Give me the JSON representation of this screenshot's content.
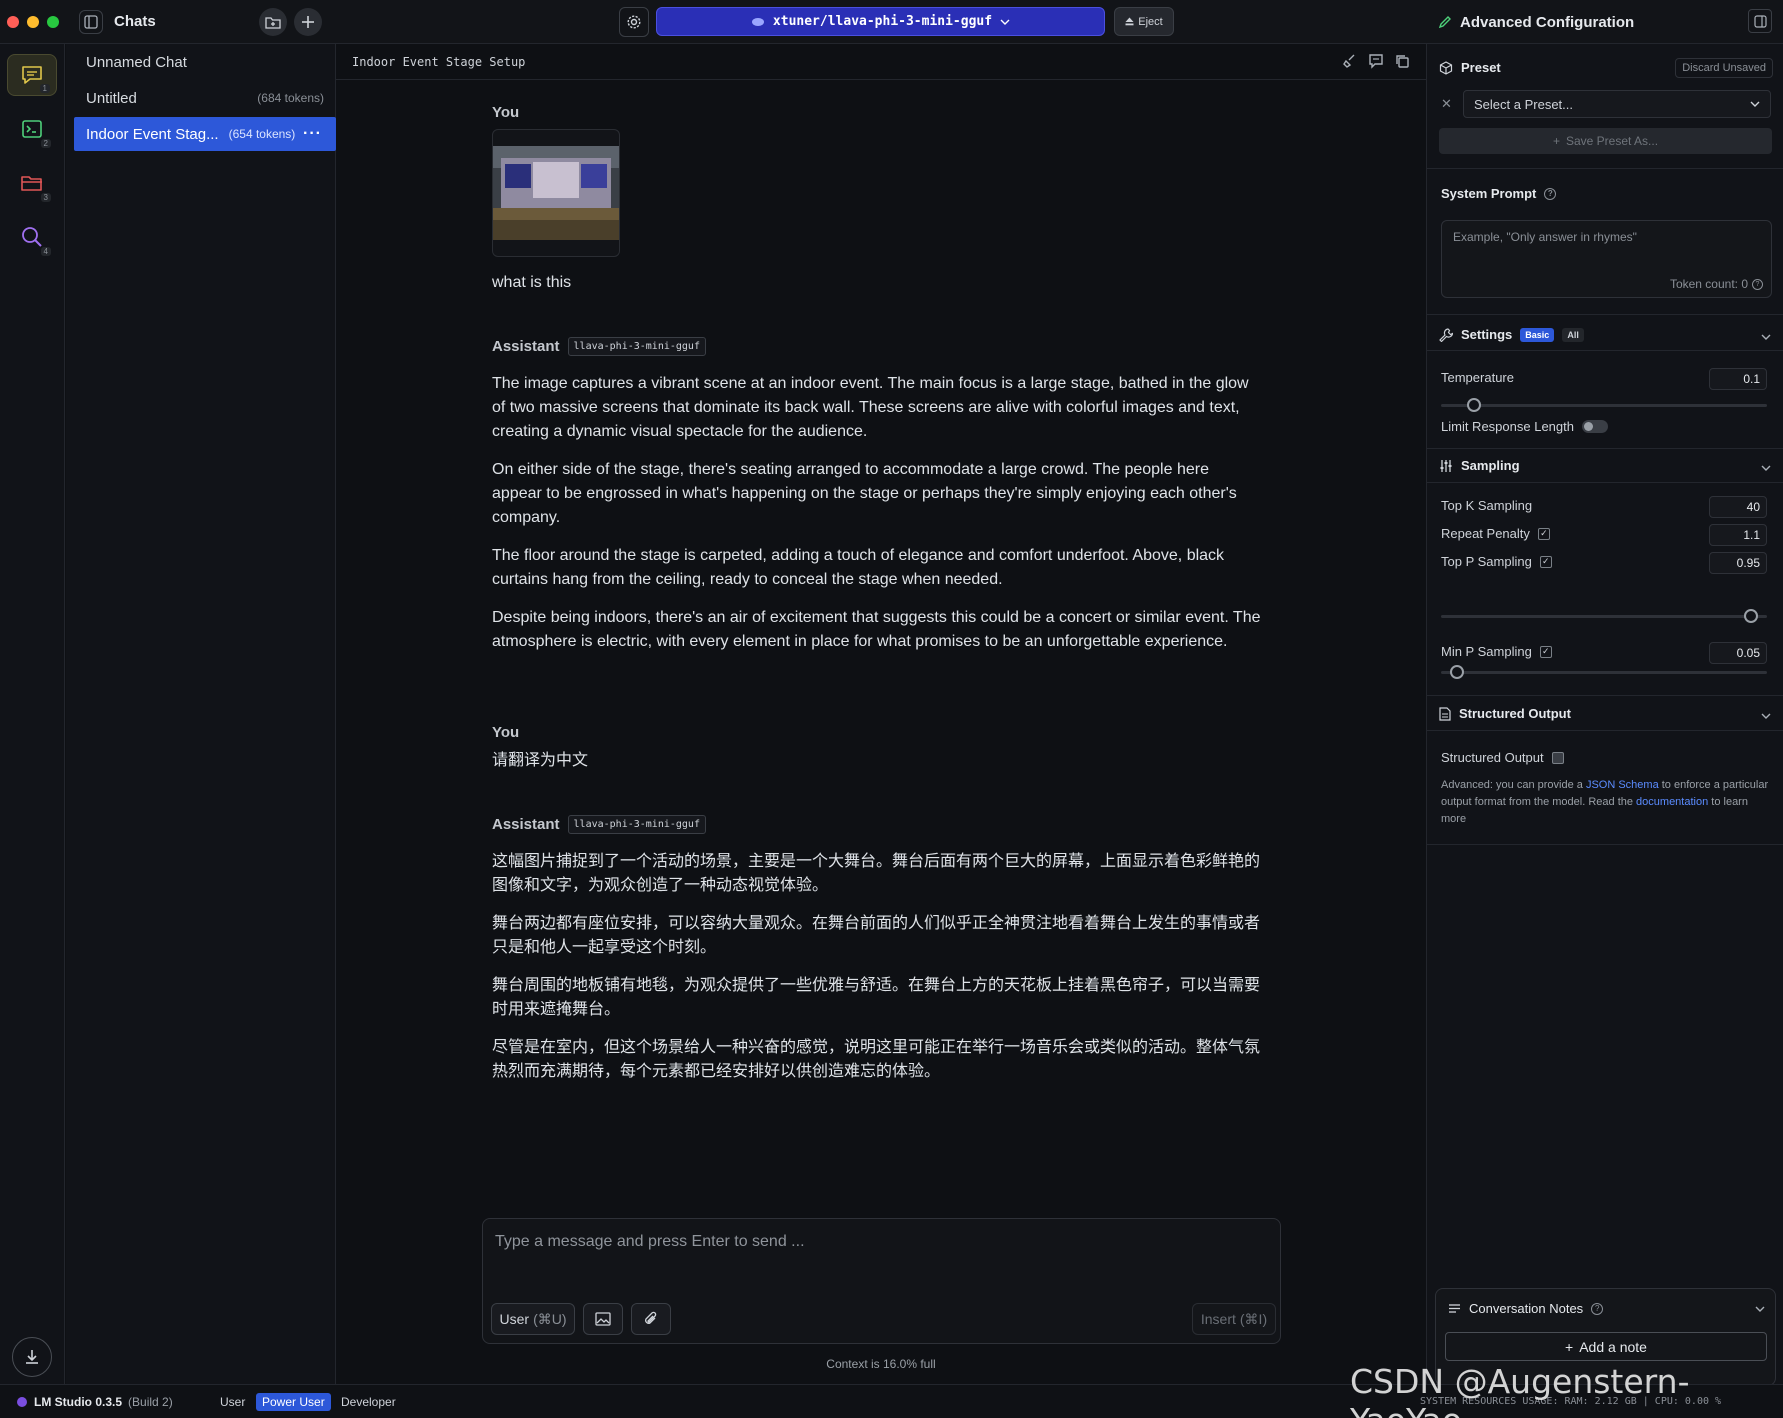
{
  "titlebar": {
    "chats_title": "Chats",
    "model_name": "xtuner/llava-phi-3-mini-gguf",
    "eject_label": "Eject",
    "panel_title": "Advanced Configuration"
  },
  "rail": {
    "items": [
      {
        "name": "chat",
        "num": "1"
      },
      {
        "name": "terminal",
        "num": "2"
      },
      {
        "name": "folder",
        "num": "3"
      },
      {
        "name": "search",
        "num": "4"
      }
    ]
  },
  "chats": [
    {
      "title": "Unnamed Chat",
      "tokens": ""
    },
    {
      "title": "Untitled",
      "tokens": "(684 tokens)"
    },
    {
      "title": "Indoor Event Stag...",
      "tokens": "(654 tokens)"
    }
  ],
  "main": {
    "chat_title": "Indoor Event Stage Setup",
    "messages": [
      {
        "role": "You",
        "text": "what is this"
      },
      {
        "role": "Assistant",
        "model": "llava-phi-3-mini-gguf",
        "paragraphs": [
          "The image captures a vibrant scene at an indoor event. The main focus is a large stage, bathed in the glow of two massive screens that dominate its back wall. These screens are alive with colorful images and text, creating a dynamic visual spectacle for the audience.",
          "On either side of the stage, there's seating arranged to accommodate a large crowd. The people here appear to be engrossed in what's happening on the stage or perhaps they're simply enjoying each other's company.",
          "The floor around the stage is carpeted, adding a touch of elegance and comfort underfoot. Above, black curtains hang from the ceiling, ready to conceal the stage when needed.",
          "Despite being indoors, there's an air of excitement that suggests this could be a concert or similar event. The atmosphere is electric, with every element in place for what promises to be an unforgettable experience."
        ]
      },
      {
        "role": "You",
        "text": "请翻译为中文"
      },
      {
        "role": "Assistant",
        "model": "llava-phi-3-mini-gguf",
        "paragraphs": [
          "这幅图片捕捉到了一个活动的场景，主要是一个大舞台。舞台后面有两个巨大的屏幕，上面显示着色彩鲜艳的图像和文字，为观众创造了一种动态视觉体验。",
          "舞台两边都有座位安排，可以容纳大量观众。在舞台前面的人们似乎正全神贯注地看着舞台上发生的事情或者只是和他人一起享受这个时刻。",
          "舞台周围的地板铺有地毯，为观众提供了一些优雅与舒适。在舞台上方的天花板上挂着黑色帘子，可以当需要时用来遮掩舞台。",
          "尽管是在室内，但这个场景给人一种兴奋的感觉，说明这里可能正在举行一场音乐会或类似的活动。整体气氛热烈而充满期待，每个元素都已经安排好以供创造难忘的体验。"
        ]
      }
    ],
    "composer_placeholder": "Type a message and press Enter to send ...",
    "role_button": "User",
    "role_shortcut": "(⌘U)",
    "insert_button": "Insert",
    "insert_shortcut": "(⌘I)",
    "context_status": "Context is 16.0% full"
  },
  "panel": {
    "preset_label": "Preset",
    "discard_label": "Discard Unsaved",
    "preset_placeholder": "Select a Preset...",
    "save_preset": "Save Preset As...",
    "system_prompt_label": "System Prompt",
    "system_prompt_placeholder": "Example, \"Only answer in rhymes\"",
    "token_count": "Token count: 0",
    "settings_label": "Settings",
    "settings_basic": "Basic",
    "settings_all": "All",
    "temperature_label": "Temperature",
    "temperature_value": "0.1",
    "temperature_level": 0.1,
    "limit_length_label": "Limit Response Length",
    "sampling_label": "Sampling",
    "topk_label": "Top K Sampling",
    "topk_value": "40",
    "repeat_label": "Repeat Penalty",
    "repeat_value": "1.1",
    "topp_label": "Top P Sampling",
    "topp_value": "0.95",
    "topp_level": 0.95,
    "minp_label": "Min P Sampling",
    "minp_value": "0.05",
    "minp_level": 0.05,
    "structured_label": "Structured Output",
    "structured_field_label": "Structured Output",
    "structured_help_1": "Advanced: you can provide a ",
    "structured_help_link1": "JSON Schema",
    "structured_help_2": " to enforce a particular output format from the model. Read the ",
    "structured_help_link2": "documentation",
    "structured_help_3": " to learn more",
    "notes_label": "Conversation Notes",
    "add_note": "Add a note"
  },
  "status": {
    "app_name": "LM Studio 0.3.5",
    "build": "(Build 2)",
    "modes": [
      "User",
      "Power User",
      "Developer"
    ],
    "sys_resources": "SYSTEM RESOURCES USAGE:  RAM: 2.12 GB  |  CPU: 0.00 %"
  },
  "watermark": "CSDN @Augenstern-YaoYao",
  "colors": {
    "accent": "#2d58d9",
    "model_button": "#2a2fb6",
    "background": "#0e1014"
  }
}
